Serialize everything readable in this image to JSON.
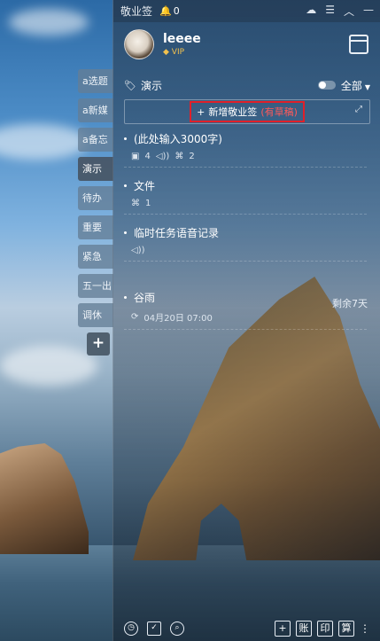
{
  "app": {
    "title": "敬业签",
    "notif_count": "0"
  },
  "user": {
    "name": "leeee",
    "badge": "VIP"
  },
  "side_tabs": [
    {
      "label": "a选题"
    },
    {
      "label": "a新媒"
    },
    {
      "label": "a备忘"
    },
    {
      "label": "演示",
      "active": true
    },
    {
      "label": "待办"
    },
    {
      "label": "重要"
    },
    {
      "label": "紧急"
    },
    {
      "label": "五一出"
    },
    {
      "label": "调休"
    }
  ],
  "side_add": "+",
  "filter": {
    "current_tag": "演示",
    "all_label": "全部"
  },
  "new_note": {
    "label": "新增敬业签",
    "draft_label": "(有草稿)"
  },
  "notes": [
    {
      "title": "(此处输入3000字)",
      "meta": [
        "4",
        "2"
      ]
    },
    {
      "title": "文件",
      "meta": [
        "1"
      ]
    },
    {
      "title": "临时任务语音记录",
      "meta": []
    },
    {
      "title": "谷雨",
      "meta": [
        "04月20日 07:00"
      ]
    }
  ],
  "remain_text": "剩余7天",
  "bottom": {
    "btn_add": "+",
    "btn_account": "账",
    "btn_print": "印",
    "btn_calc": "算"
  },
  "colors": {
    "accent_red": "#e0202a",
    "draft_red": "#ff5a5a"
  }
}
